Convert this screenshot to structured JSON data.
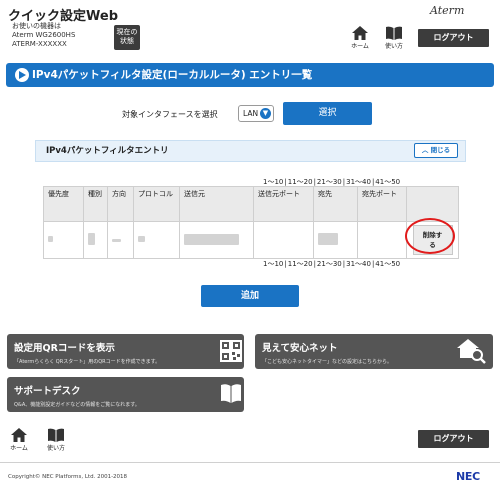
{
  "header": {
    "app_title": "クイック設定Web",
    "device_line1": "お使いの機器は",
    "device_line2": "Aterm WG2600HS",
    "device_line3": "ATERM-XXXXXX",
    "status_line1": "現在の",
    "status_line2": "状態",
    "brand": "Aterm",
    "home_label": "ホーム",
    "usage_label": "使い方",
    "logout_label": "ログアウト"
  },
  "page_title": "IPv4パケットフィルタ設定(ローカルルータ) エントリ一覧",
  "interface": {
    "label": "対象インタフェースを選択",
    "selected": "LAN",
    "select_button": "選択"
  },
  "entry_section": {
    "title": "IPv4パケットフィルタエントリ",
    "close_label": "閉じる"
  },
  "pager": [
    "1～10",
    "11～20",
    "21～30",
    "31～40",
    "41～50"
  ],
  "table": {
    "headers": [
      "優先度",
      "種別",
      "方向",
      "プロトコル",
      "送信元",
      "送信元ポート",
      "宛先",
      "宛先ポート",
      ""
    ],
    "row": {
      "delete_line1": "削除す",
      "delete_line2": "る"
    }
  },
  "add_button": "追加",
  "panels": {
    "qr_title": "設定用QRコードを表示",
    "qr_desc": "「Atermらくらく QRスタート」用のQRコードを作成できます。",
    "safe_title": "見えて安心ネット",
    "safe_desc": "「こども安心ネットタイマー」などの設定はこちらから。",
    "support_title": "サポートデスク",
    "support_desc": "Q&A、機能別設定ガイドなどの情報をご覧になれます。"
  },
  "footer": {
    "home_label": "ホーム",
    "usage_label": "使い方",
    "logout_label": "ログアウト",
    "copyright": "Copyright© NEC Platforms, Ltd. 2001-2018",
    "nec": "NEC"
  },
  "colors": {
    "accent": "#1a73c4",
    "dark_button": "#3c3c3c",
    "panel": "#555555",
    "highlight_ring": "#e11b1b"
  }
}
